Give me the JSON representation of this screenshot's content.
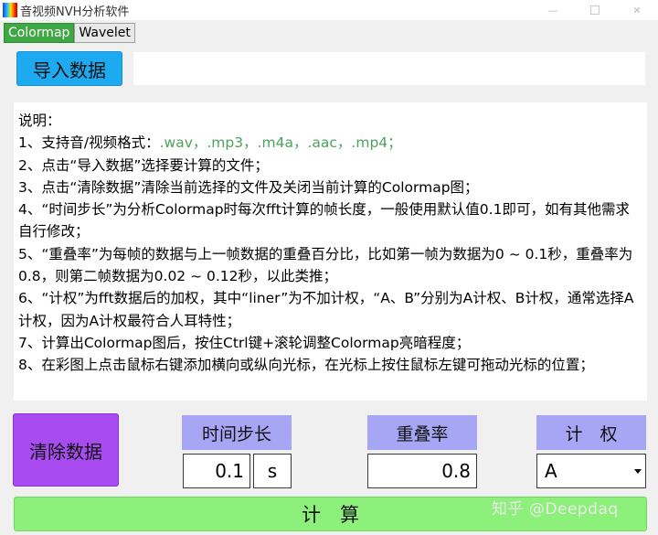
{
  "window": {
    "title": "音视频NVH分析软件"
  },
  "tabs": [
    {
      "label": "Colormap",
      "active": true
    },
    {
      "label": "Wavelet",
      "active": false
    }
  ],
  "import_button": {
    "label": "导入数据"
  },
  "file_path": {
    "value": ""
  },
  "instructions": {
    "heading": "说明：",
    "line1_prefix": "1、支持音/视频格式：",
    "line1_formats": ".wav，.mp3，.m4a，.aac，.mp4；",
    "line2": "2、点击“导入数据”选择要计算的文件；",
    "line3": "3、点击“清除数据”清除当前选择的文件及关闭当前计算的Colormap图；",
    "line4": "4、“时间步长”为分析Colormap时每次fft计算的帧长度，一般使用默认值0.1即可，如有其他需求自行修改；",
    "line5": "5、“重叠率”为每帧的数据与上一帧数据的重叠百分比，比如第一帧为数据为0 ~ 0.1秒，重叠率为0.8，则第二帧数据为0.02 ~ 0.12秒，以此类推；",
    "line6": "6、“计权”为fft数据后的加权，其中“liner”为不加计权，“A、B”分别为A计权、B计权，通常选择A计权，因为A计权最符合人耳特性；",
    "line7": "7、计算出Colormap图后，按住Ctrl键+滚轮调整Colormap亮暗程度；",
    "line8": "8、在彩图上点击鼠标右键添加横向或纵向光标，在光标上按住鼠标左键可拖动光标的位置；"
  },
  "clear_button": {
    "label": "清除数据"
  },
  "params": {
    "time_step": {
      "label": "时间步长",
      "value": "0.1",
      "unit": "s"
    },
    "overlap": {
      "label": "重叠率",
      "value": "0.8"
    },
    "weighting": {
      "label": "计　权",
      "value": "A"
    }
  },
  "compute_button": {
    "label": "计　算"
  },
  "watermark": "知乎 @Deepdaq",
  "colors": {
    "tab_active": "#3fa845",
    "import_button": "#1eaaf0",
    "clear_button": "#a84cf2",
    "param_label": "#a6a6f5",
    "compute_button": "#8cf07a",
    "format_text": "#4aa35a"
  }
}
